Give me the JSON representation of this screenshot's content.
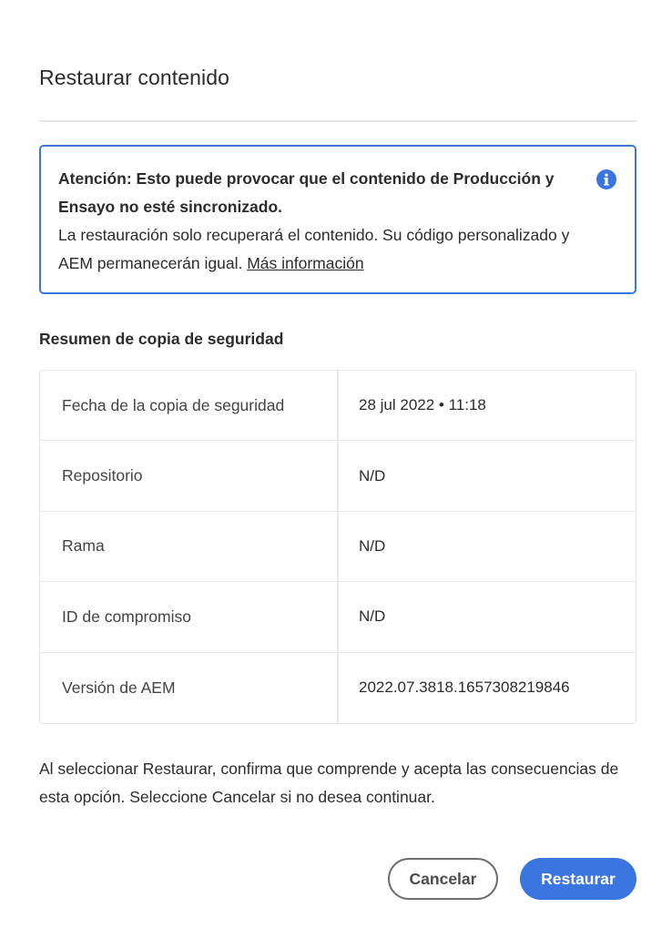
{
  "dialog": {
    "title": "Restaurar contenido"
  },
  "alert": {
    "heading": "Atención: Esto puede provocar que el contenido de Producción y Ensayo no esté sincronizado.",
    "body": "La restauración solo recuperará el contenido. Su código personalizado y AEM permanecerán igual.",
    "link_label": "Más información",
    "icon": "info-icon",
    "accent_color": "#3b76e0"
  },
  "summary": {
    "heading": "Resumen de copia de seguridad",
    "rows": [
      {
        "label": "Fecha de la copia de seguridad",
        "value": "28 jul 2022 • 11:18"
      },
      {
        "label": "Repositorio",
        "value": "N/D"
      },
      {
        "label": "Rama",
        "value": "N/D"
      },
      {
        "label": "ID de compromiso",
        "value": "N/D"
      },
      {
        "label": "Versión de AEM",
        "value": "2022.07.3818.1657308219846"
      }
    ]
  },
  "confirm_text": "Al seleccionar Restaurar, confirma que comprende y acepta las consecuencias de esta opción. Seleccione Cancelar si no desea continuar.",
  "buttons": {
    "cancel_label": "Cancelar",
    "restore_label": "Restaurar",
    "primary_color": "#3b76e0"
  }
}
